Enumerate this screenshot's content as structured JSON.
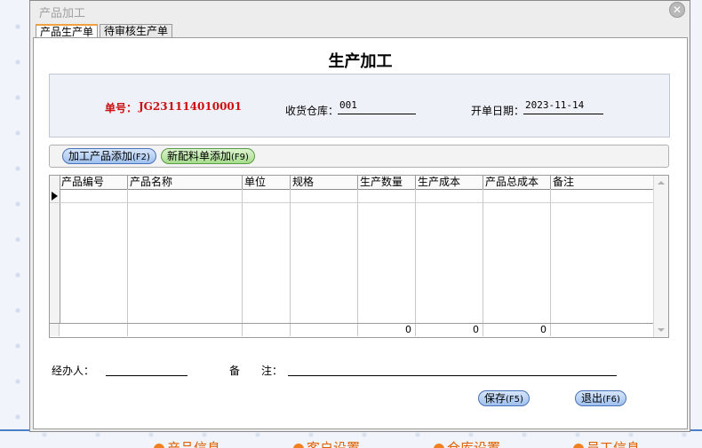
{
  "window": {
    "title": "产品加工",
    "close_symbol": "✕"
  },
  "tabs": [
    {
      "label": "产品生产单",
      "active": true
    },
    {
      "label": "待审核生产单",
      "active": false
    }
  ],
  "form": {
    "title": "生产加工",
    "order_label": "单号：",
    "order_no": "JG231114010001",
    "warehouse_label": "收货仓库：",
    "warehouse_value": "001",
    "date_label": "开单日期：",
    "date_value": "2023-11-14"
  },
  "buttons": {
    "add_product": "加工产品添加",
    "add_product_key": "(F2)",
    "add_material": "新配料单添加",
    "add_material_key": "(F9)",
    "save": "保存",
    "save_key": "(F5)",
    "exit": "退出",
    "exit_key": "(F6)"
  },
  "grid": {
    "columns": [
      "产品编号",
      "产品名称",
      "单位",
      "规格",
      "生产数量",
      "生产成本",
      "产品总成本",
      "备注"
    ],
    "totals": {
      "quantity": "0",
      "cost": "0",
      "total_cost": "0"
    }
  },
  "footer": {
    "handler_label": "经办人：",
    "remark_label": "备　　注："
  },
  "bottom_nav": [
    {
      "label": "产品信息"
    },
    {
      "label": "客户设置"
    },
    {
      "label": "仓库设置"
    },
    {
      "label": "员工信息"
    }
  ],
  "colors": {
    "order_no": "#cc1010",
    "nav_text": "#e06000",
    "accent_blue": "#4a80c8"
  }
}
